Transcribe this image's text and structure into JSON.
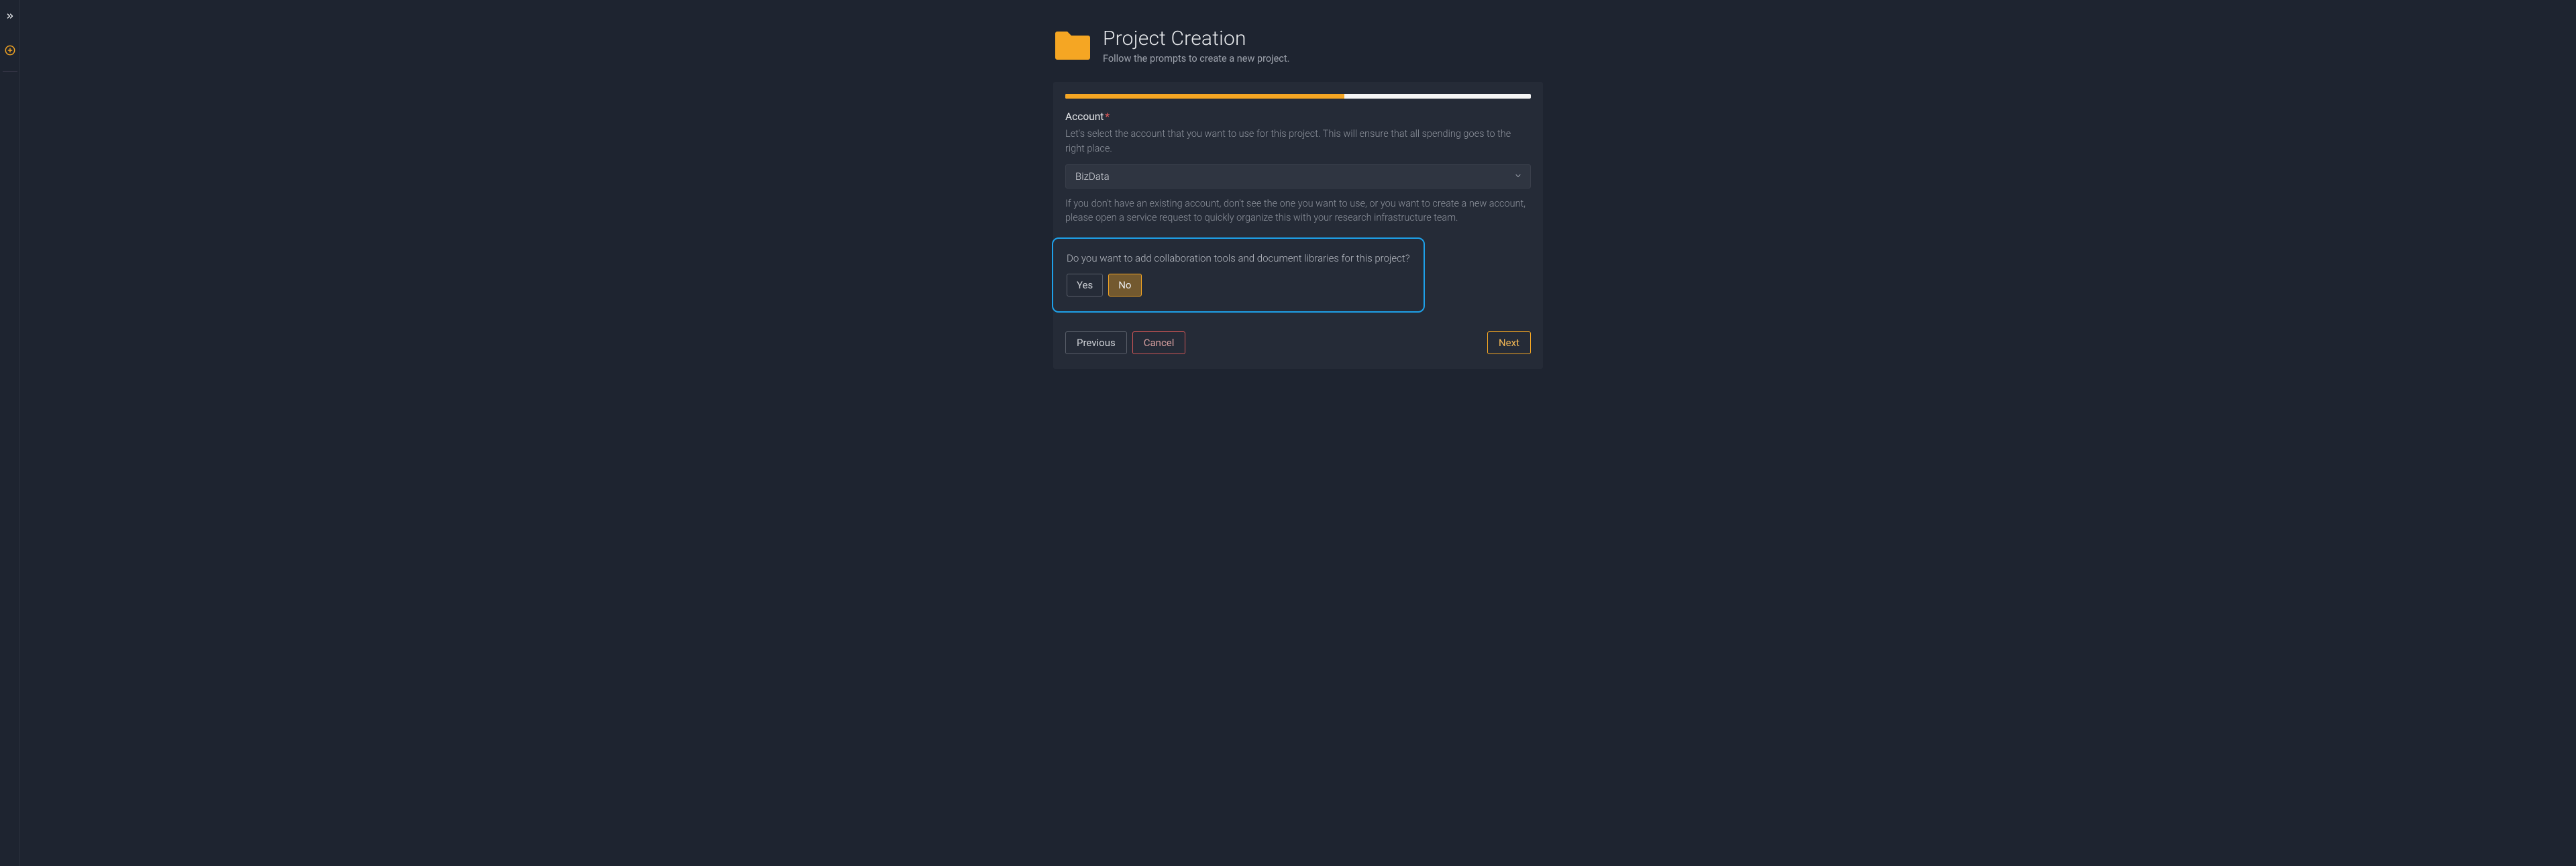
{
  "sidebar": {
    "expandIcon": "expand",
    "plusIcon": "add"
  },
  "header": {
    "title": "Project Creation",
    "subtitle": "Follow the prompts to create a new project."
  },
  "progress": {
    "percent": 60
  },
  "account": {
    "label": "Account",
    "requiredMark": "*",
    "hint": "Let's select the account that you want to use for this project. This will ensure that all spending goes to the right place.",
    "selected": "BizData",
    "note": "If you don't have an existing account, don't see the one you want to use, or you want to create a new account, please open a service request to quickly organize this with your research infrastructure team."
  },
  "collab": {
    "question": "Do you want to add collaboration tools and document libraries for this project?",
    "yesLabel": "Yes",
    "noLabel": "No",
    "selected": "no"
  },
  "nav": {
    "previous": "Previous",
    "cancel": "Cancel",
    "next": "Next"
  },
  "colors": {
    "accent": "#f5a623",
    "highlight": "#1ea0e8",
    "danger": "#d05656"
  }
}
